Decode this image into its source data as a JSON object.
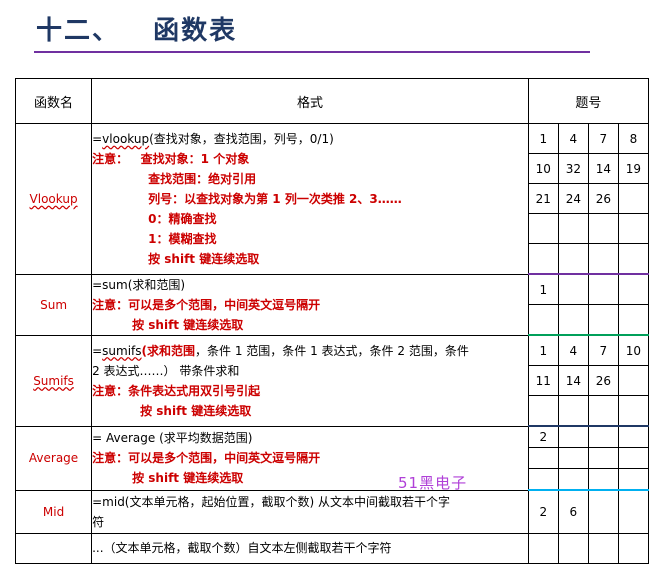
{
  "title": "十二、   函数表",
  "headers": {
    "name": "函数名",
    "format": "格式",
    "number": "题号"
  },
  "rows": {
    "vlookup": {
      "name": "Vlookup",
      "syntax_fn": "vlookup",
      "syntax_rest": "(查找对象，查找范围，列号，0/1)",
      "note_label": "注意：",
      "notes": [
        "查找对象：1 个对象",
        "查找范围：绝对引用",
        "列号：以查找对象为第 1 列一次类推 2、3……",
        "0：精确查找",
        "1：模糊查找",
        "按 shift 键连续选取"
      ],
      "nums": [
        [
          "1",
          "4",
          "7",
          "8"
        ],
        [
          "10",
          "32",
          "14",
          "19"
        ],
        [
          "21",
          "24",
          "26",
          ""
        ],
        [
          "",
          "",
          "",
          ""
        ],
        [
          "",
          "",
          "",
          ""
        ]
      ]
    },
    "sum": {
      "name": "Sum",
      "syntax": "=sum(求和范围)",
      "note": "注意：可以是多个范围，中间英文逗号隔开",
      "note2": "按 shift 键连续选取",
      "nums": [
        [
          "1",
          "",
          "",
          ""
        ],
        [
          "",
          "",
          "",
          ""
        ]
      ]
    },
    "sumifs": {
      "name": "Sumifs",
      "syntax_fn": "sumifs",
      "syntax_red": "(求和范围",
      "syntax_rest": "，条件 1 范围，条件 1 表达式，条件 2 范围，条件",
      "syntax_line2": "2 表达式……）  带条件求和",
      "note": "注意：条件表达式用双引号引起",
      "note2": "按 shift 键连续选取",
      "nums": [
        [
          "1",
          "4",
          "7",
          "10"
        ],
        [
          "11",
          "14",
          "26",
          ""
        ],
        [
          "",
          "",
          "",
          ""
        ]
      ]
    },
    "average": {
      "name": "Average",
      "syntax": "= Average (求平均数据范围)",
      "note": "注意：可以是多个范围，中间英文逗号隔开",
      "note2": "按 shift 键连续选取",
      "nums": [
        [
          "2",
          "",
          "",
          ""
        ],
        [
          "",
          "",
          "",
          ""
        ],
        [
          "",
          "",
          "",
          ""
        ]
      ]
    },
    "mid": {
      "name": "Mid",
      "syntax": "=mid(文本单元格，起始位置，截取个数)   从文本中间截取若干个字",
      "syntax_line2": "符",
      "nums": [
        [
          "2",
          "6",
          "",
          ""
        ]
      ]
    },
    "last": {
      "partial": "...（文本单元格，截取个数）自文本左侧截取若干个字符"
    }
  },
  "watermark": "51黑电子"
}
